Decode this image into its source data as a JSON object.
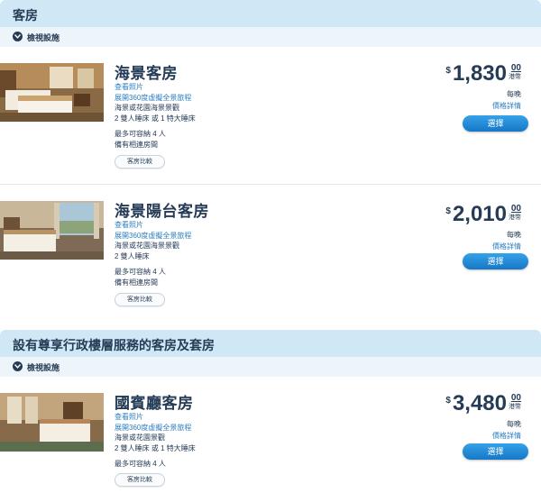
{
  "sections": [
    {
      "title": "客房",
      "facilities_label": "檢視設施",
      "rooms": [
        {
          "name": "海景客房",
          "photos_link": "查看照片",
          "tour_link": "展開360度虛擬全景旅程",
          "view": "海景或花園海景景觀",
          "beds": "2 雙人睡床 或 1 特大睡床",
          "capacity": "最多可容納 4 人",
          "connecting": "備有相連房間",
          "compare": "客房比較",
          "currency": "$",
          "price": "1,830",
          "cents": "00",
          "unit": "港幣",
          "per": "每晚",
          "detail": "價格詳情",
          "select": "選擇"
        },
        {
          "name": "海景陽台客房",
          "photos_link": "查看照片",
          "tour_link": "展開360度虛擬全景旅程",
          "view": "海景或花園海景景觀",
          "beds": "2 雙人睡床",
          "capacity": "最多可容納 4 人",
          "connecting": "備有相連房間",
          "compare": "客房比較",
          "currency": "$",
          "price": "2,010",
          "cents": "00",
          "unit": "港幣",
          "per": "每晚",
          "detail": "價格詳情",
          "select": "選擇"
        }
      ]
    },
    {
      "title": "設有尊享行政樓層服務的客房及套房",
      "facilities_label": "檢視設施",
      "rooms": [
        {
          "name": "國賓廳客房",
          "photos_link": "查看照片",
          "tour_link": "展開360度虛擬全景旅程",
          "view": "海景或花園景觀",
          "beds": "2 雙人睡床 或 1 特大睡床",
          "capacity": "最多可容納 4 人",
          "compare": "客房比較",
          "currency": "$",
          "price": "3,480",
          "cents": "00",
          "unit": "港幣",
          "per": "每晚",
          "detail": "價格詳情",
          "select": "選擇"
        }
      ]
    }
  ]
}
